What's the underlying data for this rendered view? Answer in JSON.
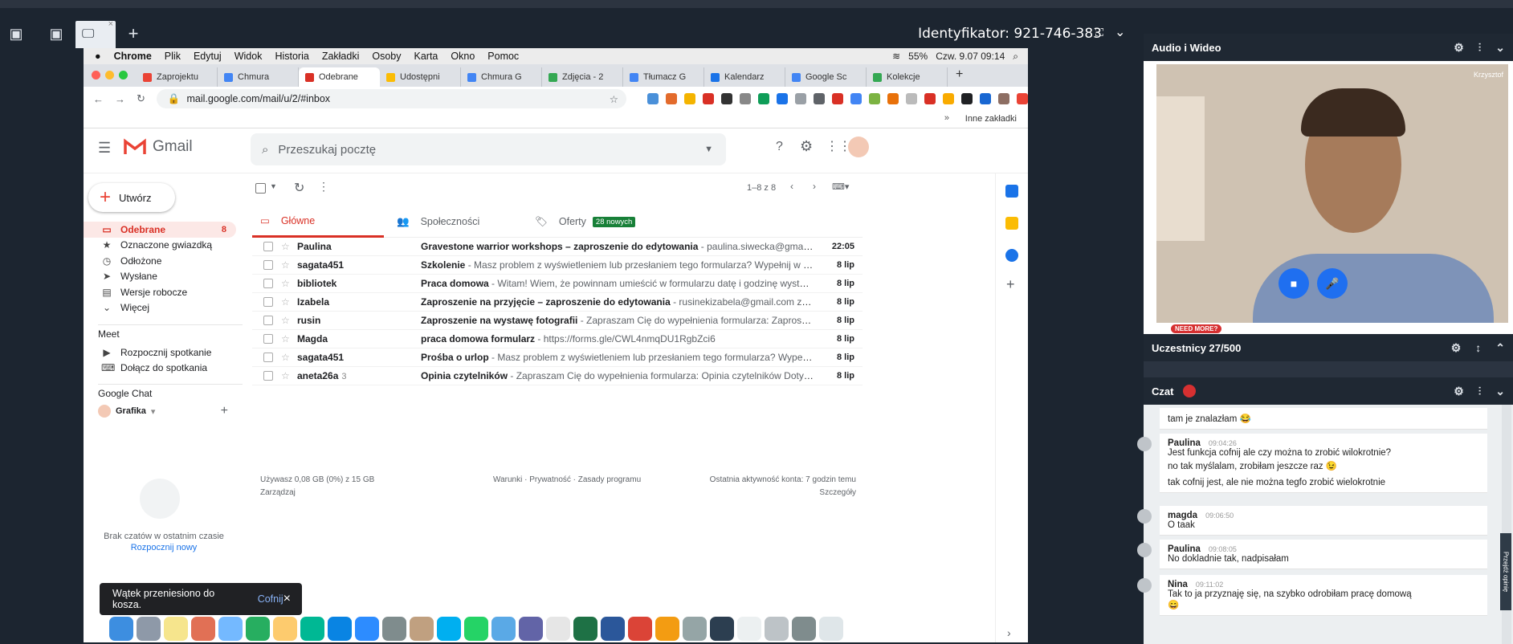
{
  "viewer": {
    "identifier": "Identyfikator: 921-746-383"
  },
  "mac_menu": {
    "app": "Chrome",
    "items": [
      "Plik",
      "Edytuj",
      "Widok",
      "Historia",
      "Zakładki",
      "Osoby",
      "Karta",
      "Okno",
      "Pomoc"
    ],
    "battery": "55%",
    "clock": "Czw. 9.07  09:14"
  },
  "tabs": [
    {
      "label": "Zaprojektu",
      "color": "#ea4335"
    },
    {
      "label": "Chmura",
      "color": "#4285f4"
    },
    {
      "label": "Odebrane",
      "color": "#d93025",
      "active": true
    },
    {
      "label": "Udostępni",
      "color": "#fbbc04"
    },
    {
      "label": "Chmura G",
      "color": "#4285f4"
    },
    {
      "label": "Zdjęcia - 2",
      "color": "#34a853"
    },
    {
      "label": "Tłumacz G",
      "color": "#4285f4"
    },
    {
      "label": "Kalendarz",
      "color": "#1a73e8"
    },
    {
      "label": "Google Sc",
      "color": "#4285f4"
    },
    {
      "label": "Kolekcje",
      "color": "#34a853"
    }
  ],
  "address": {
    "url": "mail.google.com/mail/u/2/#inbox"
  },
  "bookmarks": {
    "other": "Inne zakładki"
  },
  "gmail": {
    "logo_text": "Gmail",
    "search_placeholder": "Przeszukaj pocztę",
    "compose": "Utwórz",
    "nav": [
      {
        "label": "Odebrane",
        "count": "8",
        "icon": "inbox-icon",
        "active": true
      },
      {
        "label": "Oznaczone gwiazdką",
        "icon": "star-icon"
      },
      {
        "label": "Odłożone",
        "icon": "clock-icon"
      },
      {
        "label": "Wysłane",
        "icon": "send-icon"
      },
      {
        "label": "Wersje robocze",
        "icon": "draft-icon"
      },
      {
        "label": "Więcej",
        "icon": "chevron-down-icon"
      }
    ],
    "meet": {
      "title": "Meet",
      "start": "Rozpocznij spotkanie",
      "join": "Dołącz do spotkania"
    },
    "chat": {
      "title": "Google Chat",
      "user": "Grafika",
      "empty": "Brak czatów w ostatnim czasie",
      "start_new": "Rozpocznij nowy"
    },
    "pagination": "1–8 z 8",
    "categories": {
      "primary": "Główne",
      "social": "Społeczności",
      "promotions": "Oferty",
      "promo_badge": "28 nowych"
    },
    "emails": [
      {
        "sender": "Paulina",
        "count": "",
        "subject": "Gravestone warrior workshops – zaproszenie do edytowania",
        "snippet": " - paulina.siwecka@gmail.com zaprasza Cię do edy…",
        "date": "22:05"
      },
      {
        "sender": "sagata451",
        "count": "",
        "subject": "Szkolenie",
        "snippet": " - Masz problem z wyświetleniem lub przesłaniem tego formularza? Wypełnij w Formularzach Google …",
        "date": "8 lip"
      },
      {
        "sender": "bibliotek",
        "count": "",
        "subject": "Praca domowa",
        "snippet": " - Witam! Wiem, że powinnam umieścić w formularzu datę i godzinę wystawy ale przeoczyłam z p…",
        "date": "8 lip"
      },
      {
        "sender": "Izabela",
        "count": "",
        "subject": "Zaproszenie na przyjęcie – zaproszenie do edytowania",
        "snippet": " - rusinekizabela@gmail.com zaprasza Cię do edytowani…",
        "date": "8 lip"
      },
      {
        "sender": "rusin",
        "count": "",
        "subject": "Zaproszenie na wystawę fotografii",
        "snippet": " - Zapraszam Cię do wypełnienia formularza: Zaproszenie na wystawę fotogr…",
        "date": "8 lip"
      },
      {
        "sender": "Magda",
        "count": "",
        "subject": "praca domowa formularz",
        "snippet": " - https://forms.gle/CWL4nmqDU1RgbZci6",
        "date": "8 lip"
      },
      {
        "sender": "sagata451",
        "count": "",
        "subject": "Prośba o urlop",
        "snippet": " - Masz problem z wyświetleniem lub przesłaniem tego formularza? Wypełnij w Formularzach Go…",
        "date": "8 lip"
      },
      {
        "sender": "aneta26a",
        "count": "3",
        "subject": "Opinia czytelników",
        "snippet": " - Zapraszam Cię do wypełnienia formularza: Opinia czytelników Dotycząca zakupu nowości …",
        "date": "8 lip"
      }
    ],
    "footer": {
      "storage": "Używasz 0,08 GB (0%) z 15 GB",
      "manage": "Zarządzaj",
      "links": "Warunki · Prywatność · Zasady programu",
      "activity": "Ostatnia aktywność konta: 7 godzin temu",
      "details": "Szczegóły"
    },
    "snackbar": {
      "text": "Wątek przeniesiono do kosza.",
      "undo": "Cofnij"
    }
  },
  "panel": {
    "av_title": "Audio i Wideo",
    "video_name": "Krzysztof",
    "need_more": "NEED MORE?",
    "participants": "Uczestnicy 27/500",
    "chat_title": "Czat",
    "messages": [
      {
        "who": "",
        "time": "",
        "lines": [
          "tam je znalazłam 😂"
        ]
      },
      {
        "who": "Paulina",
        "time": "09:04:26",
        "lines": [
          "Jest funkcja cofnij ale czy można to zrobić wilokrotnie?",
          "no tak myślalam, zrobiłam jeszcze raz 😉",
          "tak cofnij jest, ale nie można tegfo zrobić wielokrotnie"
        ]
      },
      {
        "who": "magda",
        "time": "09:06:50",
        "lines": [
          "O taak"
        ]
      },
      {
        "who": "Paulina",
        "time": "09:08:05",
        "lines": [
          "No dokladnie tak, nadpisałam"
        ]
      },
      {
        "who": "Nina",
        "time": "09:11:02",
        "lines": [
          "Tak to ja przyznaję się, na szybko odrobiłam pracę domową",
          "😄"
        ]
      }
    ],
    "side_tab": "Przejdź opinię"
  }
}
